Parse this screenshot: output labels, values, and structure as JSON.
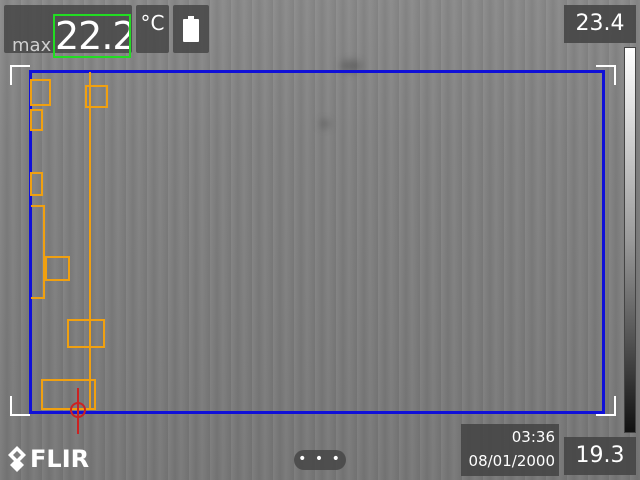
{
  "measurement": {
    "label": "max",
    "value": "22.2"
  },
  "unit": {
    "label": "°C"
  },
  "battery": {
    "icon": "battery-icon"
  },
  "scale": {
    "max": "23.4",
    "min": "19.3"
  },
  "datetime": {
    "time": "03:36",
    "date": "08/01/2000"
  },
  "brand": {
    "name": "FLIR"
  },
  "more_menu": {
    "label": "• • •"
  },
  "colors": {
    "measure_highlight": "#22dd22",
    "roi_border": "#1010d8",
    "spot_boxes": "#f0a010",
    "spot_marker": "#cc2222"
  }
}
